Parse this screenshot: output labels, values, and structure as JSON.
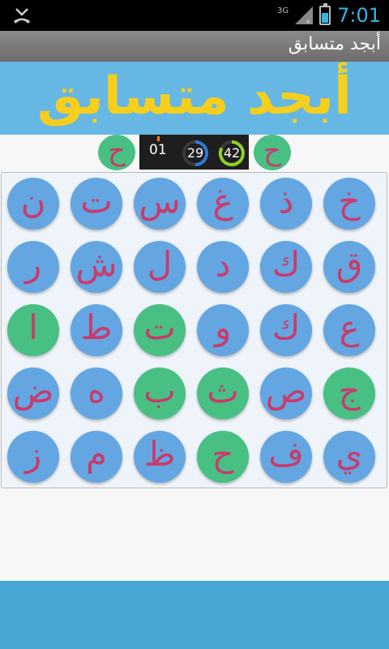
{
  "status_bar": {
    "network": "3G",
    "time": "7:01",
    "left_icon": "missed-call-icon",
    "signal_icon": "signal-icon",
    "battery_icon": "battery-charging-icon",
    "accent_color": "#33b5e5"
  },
  "action_bar": {
    "title": "أبجد متسابق"
  },
  "banner": {
    "title": "أبجد متسابق",
    "title_color": "#f6cf1e",
    "background_color": "#66b7e4"
  },
  "game": {
    "target_left": "ح",
    "target_right": "ح",
    "level": "01",
    "timer_blue": "29",
    "timer_green": "42",
    "colors": {
      "tile_blue": "#64a6e1",
      "tile_green": "#48c083",
      "letter": "#c83b6c"
    },
    "grid": [
      [
        {
          "letter": "ن",
          "state": "blue"
        },
        {
          "letter": "ت",
          "state": "blue"
        },
        {
          "letter": "س",
          "state": "blue"
        },
        {
          "letter": "غ",
          "state": "blue"
        },
        {
          "letter": "ذ",
          "state": "blue"
        },
        {
          "letter": "خ",
          "state": "blue"
        }
      ],
      [
        {
          "letter": "ر",
          "state": "blue"
        },
        {
          "letter": "ش",
          "state": "blue"
        },
        {
          "letter": "ل",
          "state": "blue"
        },
        {
          "letter": "د",
          "state": "blue"
        },
        {
          "letter": "ك",
          "state": "blue"
        },
        {
          "letter": "ق",
          "state": "blue"
        }
      ],
      [
        {
          "letter": "ا",
          "state": "green"
        },
        {
          "letter": "ط",
          "state": "blue"
        },
        {
          "letter": "ت",
          "state": "green"
        },
        {
          "letter": "و",
          "state": "blue"
        },
        {
          "letter": "ك",
          "state": "blue"
        },
        {
          "letter": "ع",
          "state": "blue"
        }
      ],
      [
        {
          "letter": "ض",
          "state": "blue"
        },
        {
          "letter": "ه",
          "state": "blue"
        },
        {
          "letter": "ب",
          "state": "green"
        },
        {
          "letter": "ث",
          "state": "green"
        },
        {
          "letter": "ص",
          "state": "blue"
        },
        {
          "letter": "ج",
          "state": "green"
        }
      ],
      [
        {
          "letter": "ز",
          "state": "blue"
        },
        {
          "letter": "م",
          "state": "blue"
        },
        {
          "letter": "ظ",
          "state": "blue"
        },
        {
          "letter": "ح",
          "state": "green"
        },
        {
          "letter": "ف",
          "state": "blue"
        },
        {
          "letter": "ي",
          "state": "blue"
        }
      ]
    ]
  }
}
